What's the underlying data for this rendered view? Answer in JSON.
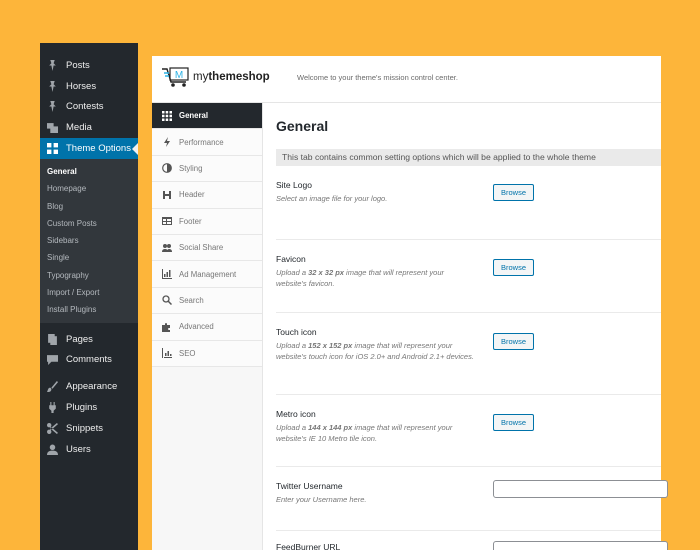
{
  "wp_menu": {
    "top": [
      {
        "label": "Posts",
        "icon": "pin-icon"
      },
      {
        "label": "Horses",
        "icon": "pin-icon"
      },
      {
        "label": "Contests",
        "icon": "pin-icon"
      },
      {
        "label": "Media",
        "icon": "media-icon"
      },
      {
        "label": "Theme Options",
        "icon": "grid-icon"
      }
    ],
    "sub": [
      "General",
      "Homepage",
      "Blog",
      "Custom Posts",
      "Sidebars",
      "Single",
      "Typography",
      "Import / Export",
      "Install Plugins"
    ],
    "bottom1": [
      {
        "label": "Pages",
        "icon": "pages-icon"
      },
      {
        "label": "Comments",
        "icon": "comments-icon"
      }
    ],
    "bottom2": [
      {
        "label": "Appearance",
        "icon": "brush-icon"
      },
      {
        "label": "Plugins",
        "icon": "plug-icon"
      },
      {
        "label": "Snippets",
        "icon": "scissors-icon"
      },
      {
        "label": "Users",
        "icon": "user-icon"
      }
    ]
  },
  "header": {
    "logo_light": "my",
    "logo_bold": "themeshop",
    "welcome": "Welcome to your theme's mission control center."
  },
  "nav": [
    {
      "label": "General",
      "icon": "grid-icon"
    },
    {
      "label": "Performance",
      "icon": "bolt-icon"
    },
    {
      "label": "Styling",
      "icon": "contrast-icon"
    },
    {
      "label": "Header",
      "icon": "heading-icon"
    },
    {
      "label": "Footer",
      "icon": "table-icon"
    },
    {
      "label": "Social Share",
      "icon": "users-icon"
    },
    {
      "label": "Ad Management",
      "icon": "chart-icon"
    },
    {
      "label": "Search",
      "icon": "search-icon"
    },
    {
      "label": "Advanced",
      "icon": "puzzle-icon"
    },
    {
      "label": "SEO",
      "icon": "bars-icon"
    }
  ],
  "content": {
    "title": "General",
    "description": "This tab contains common setting options which will be applied to the whole theme",
    "browse_label": "Browse",
    "site_logo": {
      "label": "Site Logo",
      "help": "Select an image file for your logo."
    },
    "favicon": {
      "label": "Favicon",
      "help_pre": "Upload a ",
      "help_bold": "32 x 32 px",
      "help_post": " image that will represent your website's favicon."
    },
    "touch_icon": {
      "label": "Touch icon",
      "help_pre": "Upload a ",
      "help_bold": "152 x 152 px",
      "help_post": " image that will represent your website's touch icon for iOS 2.0+ and Android 2.1+ devices."
    },
    "metro_icon": {
      "label": "Metro icon",
      "help_pre": "Upload a ",
      "help_bold": "144 x 144 px",
      "help_post": " image that will represent your website's IE 10 Metro tile icon."
    },
    "twitter": {
      "label": "Twitter Username",
      "help": "Enter your Username here.",
      "value": ""
    },
    "feedburner": {
      "label": "FeedBurner URL",
      "value": ""
    }
  }
}
